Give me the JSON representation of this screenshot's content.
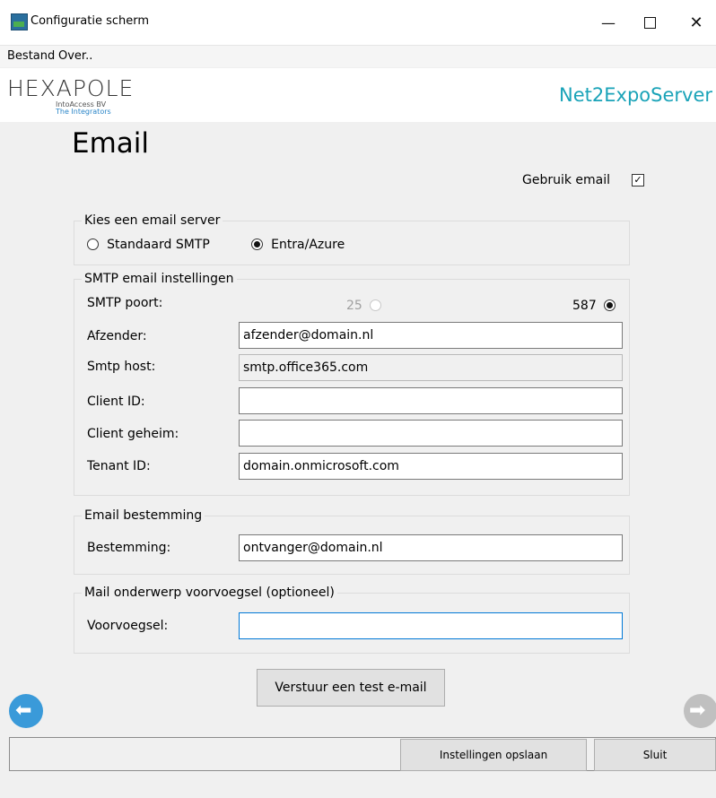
{
  "window": {
    "title": "Configuratie scherm",
    "minimize": "—",
    "maximize": "☐",
    "close": "✕"
  },
  "menu": [
    "Bestand",
    "Over.."
  ],
  "header": {
    "logo_text": "HEXAPOLE",
    "logo_sub1": "IntoAccess BV",
    "logo_sub2": "The Integrators",
    "app_name": "Net2ExpoServer"
  },
  "page": {
    "title": "Email",
    "use_email_label": "Gebruik email",
    "use_email_checked": true
  },
  "server_group": {
    "legend": "Kies een email server",
    "options": [
      {
        "label": "Standaard SMTP",
        "selected": false
      },
      {
        "label": "Entra/Azure",
        "selected": true
      }
    ]
  },
  "smtp_group": {
    "legend": "SMTP email instellingen",
    "port_label": "SMTP poort:",
    "port_options": [
      {
        "label": "25",
        "selected": false,
        "enabled": false
      },
      {
        "label": "587",
        "selected": true,
        "enabled": true
      }
    ],
    "fields": [
      {
        "label": "Afzender:",
        "value": "afzender@domain.nl",
        "readonly": false
      },
      {
        "label": "Smtp host:",
        "value": "smtp.office365.com",
        "readonly": true
      },
      {
        "label": "Client ID:",
        "value": "",
        "readonly": false
      },
      {
        "label": "Client geheim:",
        "value": "",
        "readonly": false
      },
      {
        "label": "Tenant ID:",
        "value": "domain.onmicrosoft.com",
        "readonly": false
      }
    ]
  },
  "dest_group": {
    "legend": "Email bestemming",
    "label": "Bestemming:",
    "value": "ontvanger@domain.nl"
  },
  "prefix_group": {
    "legend": "Mail onderwerp voorvoegsel (optioneel)",
    "label": "Voorvoegsel:",
    "value": ""
  },
  "buttons": {
    "test": "Verstuur een test e-mail",
    "save": "Instellingen opslaan",
    "close": "Sluit"
  },
  "nav": {
    "back_arrow": "⬅",
    "forward_arrow": "➡"
  },
  "colors": {
    "accent": "#1aa3b8",
    "nav_active": "#3a9ad9",
    "nav_disabled": "#c0c0c0",
    "focus": "#0078d7"
  }
}
